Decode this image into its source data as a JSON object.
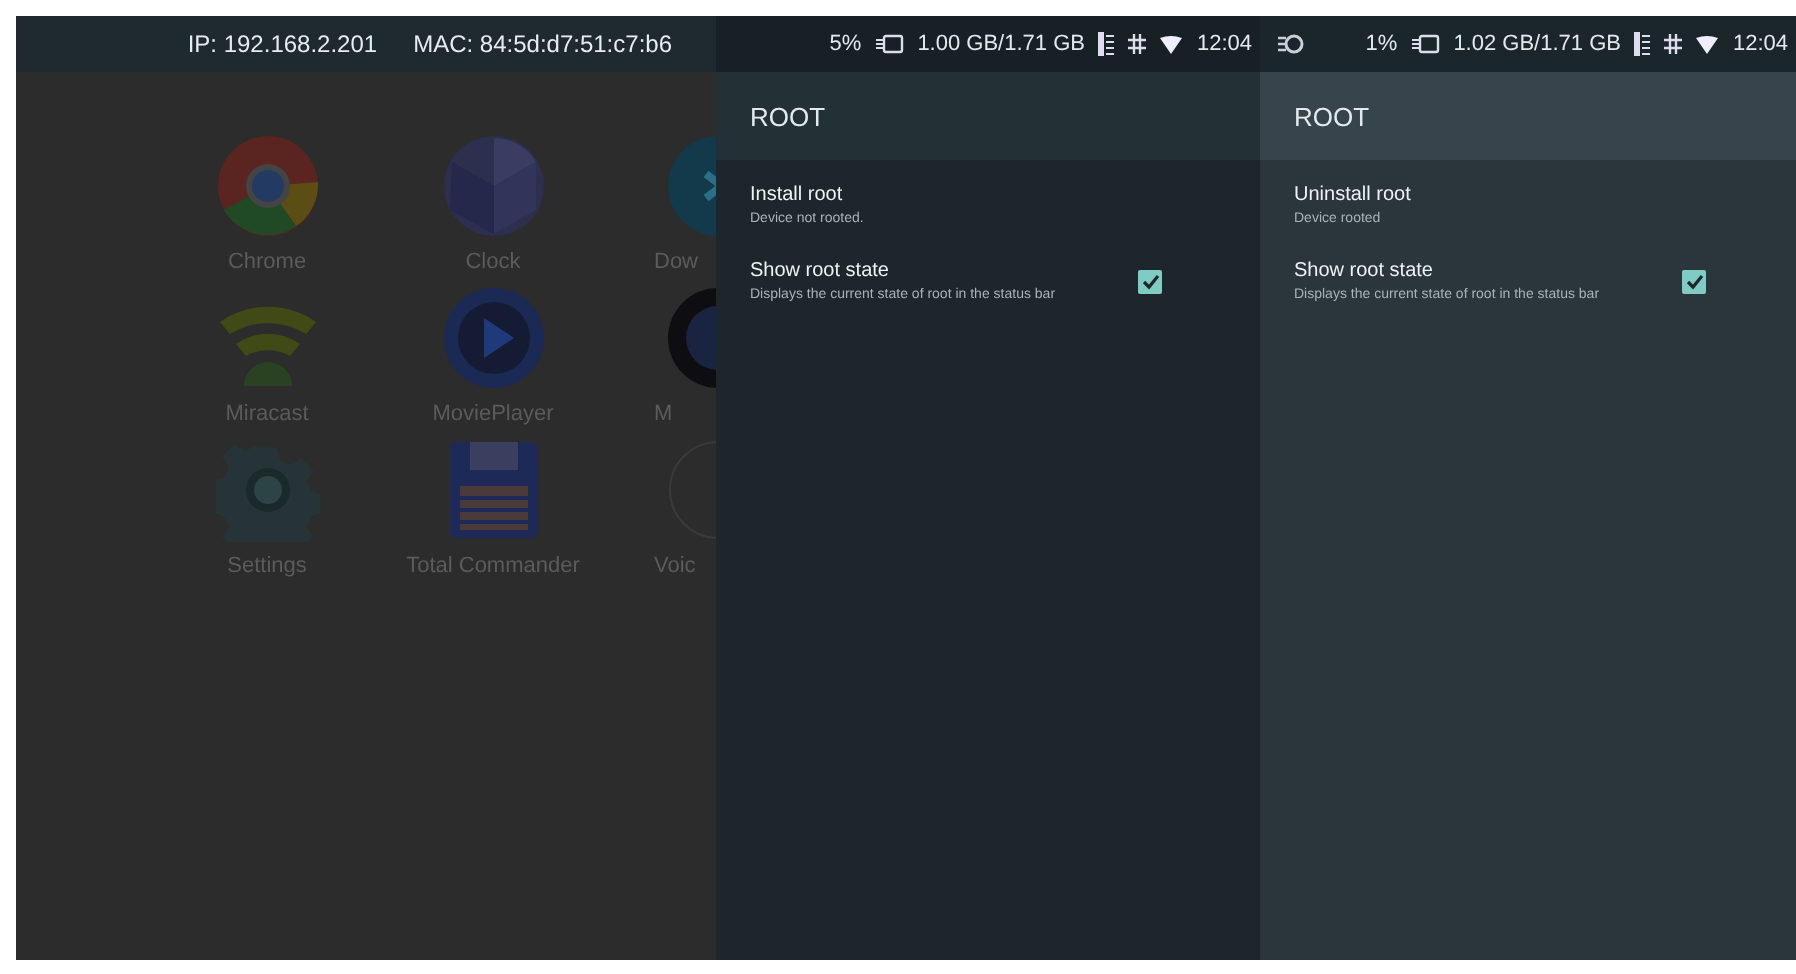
{
  "launcher": {
    "status_bar": {
      "ip": "IP: 192.168.2.201",
      "mac": "MAC: 84:5d:d7:51:c7:b6"
    },
    "apps": [
      {
        "label": "Chrome"
      },
      {
        "label": "Clock"
      },
      {
        "label": "Dow"
      },
      {
        "label": "Miracast"
      },
      {
        "label": "MoviePlayer"
      },
      {
        "label": "M"
      },
      {
        "label": "Settings"
      },
      {
        "label": "Total Commander"
      },
      {
        "label": "Voic"
      }
    ]
  },
  "panels": [
    {
      "status_bar": {
        "sync_icon": false,
        "battery": "5%",
        "memory": "1.00 GB/1.71 GB",
        "time": "12:04"
      },
      "title": "ROOT",
      "items": [
        {
          "kind": "action",
          "title": "Install root",
          "summary": "Device not rooted."
        },
        {
          "kind": "toggle",
          "title": "Show root state",
          "summary": "Displays the current state of root in the status bar",
          "checked": true
        }
      ]
    },
    {
      "status_bar": {
        "sync_icon": true,
        "battery": "1%",
        "memory": "1.02 GB/1.71 GB",
        "time": "12:04"
      },
      "title": "ROOT",
      "items": [
        {
          "kind": "action",
          "title": "Uninstall root",
          "summary": "Device rooted"
        },
        {
          "kind": "toggle",
          "title": "Show root state",
          "summary": "Displays the current state of root in the status bar",
          "checked": true
        }
      ]
    }
  ]
}
